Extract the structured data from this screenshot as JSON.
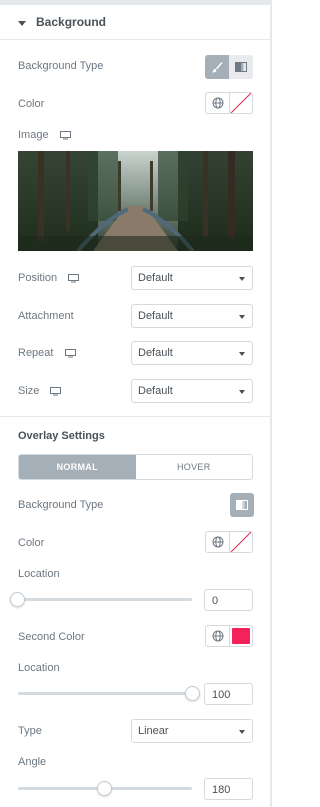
{
  "section": {
    "title": "Background"
  },
  "background": {
    "type_label": "Background Type",
    "color_label": "Color",
    "image_label": "Image",
    "position": {
      "label": "Position",
      "value": "Default"
    },
    "attachment": {
      "label": "Attachment",
      "value": "Default"
    },
    "repeat": {
      "label": "Repeat",
      "value": "Default"
    },
    "size": {
      "label": "Size",
      "value": "Default"
    }
  },
  "overlay": {
    "title": "Overlay Settings",
    "tabs": {
      "normal": "NORMAL",
      "hover": "HOVER"
    },
    "type_label": "Background Type",
    "color_label": "Color",
    "location_label": "Location",
    "location_value": "0",
    "second_color_label": "Second Color",
    "second_color": "#f3225d",
    "location2_label": "Location",
    "location2_value": "100",
    "type": {
      "label": "Type",
      "value": "Linear"
    },
    "angle_label": "Angle",
    "angle_value": "180"
  },
  "colors": {
    "accent_gray": "#a4afb7",
    "label_text": "#6d7882",
    "heading_text": "#495157",
    "border": "#d5dadf"
  },
  "icons": [
    "caret-down-icon",
    "brush-icon",
    "gradient-icon",
    "globe-icon",
    "monitor-icon",
    "dropdown-arrow-icon"
  ]
}
